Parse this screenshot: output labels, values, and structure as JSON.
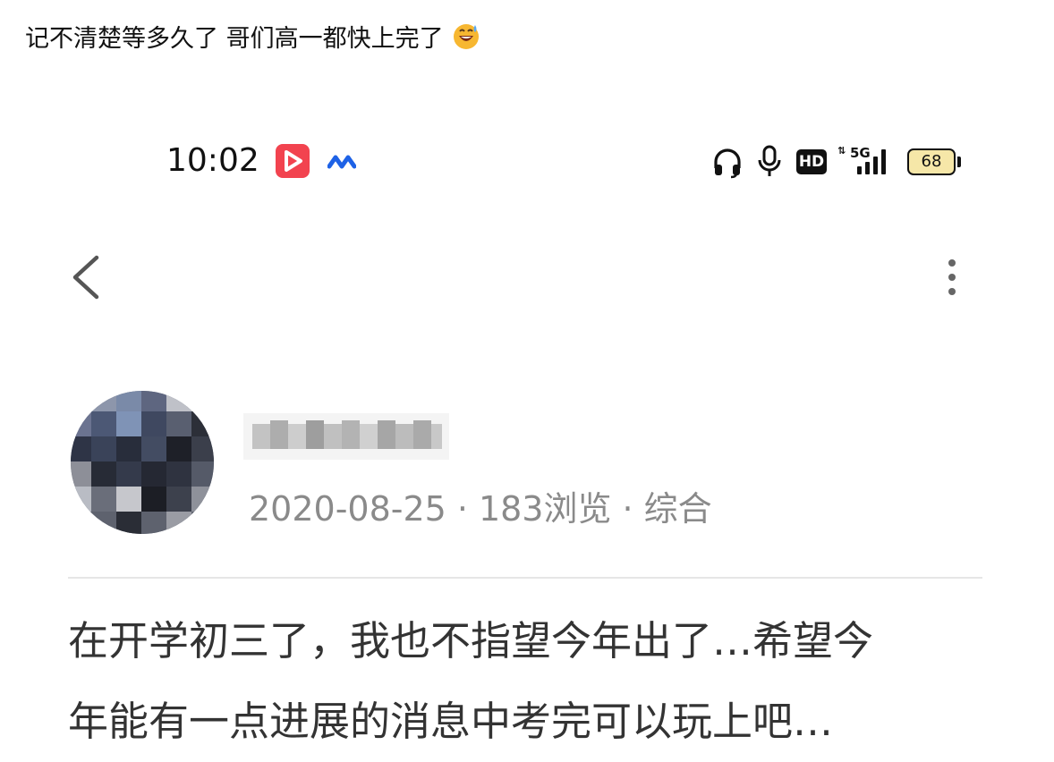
{
  "caption": {
    "text": "记不清楚等多久了 哥们高一都快上完了",
    "emoji_icon": "grinning-sweat-emoji"
  },
  "status_bar": {
    "time": "10:02",
    "left_icons": [
      "video-app-icon",
      "app-logo-icon"
    ],
    "right_icons": [
      "headset-icon",
      "microphone-icon",
      "hd-icon",
      "signal-5g-icon",
      "battery-icon"
    ],
    "network": "5G",
    "hd_label": "HD",
    "battery_level": "68"
  },
  "nav": {
    "back_icon": "chevron-left-icon",
    "more_icon": "vertical-dots-icon"
  },
  "post": {
    "date": "2020-08-25",
    "views": "183浏览",
    "category": "综合",
    "separator": "·",
    "body_lines": [
      "在开学初三了，我也不指望今年出了…希望今",
      "年能有一点进展的消息中考完可以玩上吧…"
    ]
  },
  "colors": {
    "video_app_red": "#f2434f",
    "app_logo_blue": "#1e62e6",
    "meta_gray": "#8a8a8a",
    "divider": "#e6e6e6",
    "battery_fill": "#f6e7a8"
  }
}
